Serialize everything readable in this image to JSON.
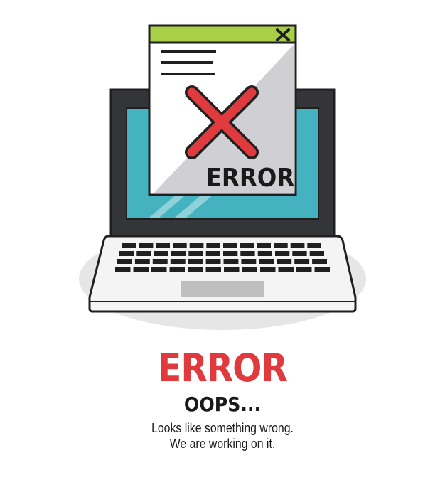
{
  "illustration": {
    "window_error_label": "ERROR",
    "close_icon": "close-x-icon",
    "error_icon": "red-x-icon"
  },
  "message": {
    "heading": "ERROR",
    "subheading": "OOPS...",
    "line1": "Looks like something wrong.",
    "line2": "We are working on it."
  },
  "colors": {
    "accent_red": "#e03a3e",
    "window_bar": "#a8cf45",
    "screen": "#45b3bf",
    "frame": "#333538",
    "outline": "#1f1f1f"
  }
}
